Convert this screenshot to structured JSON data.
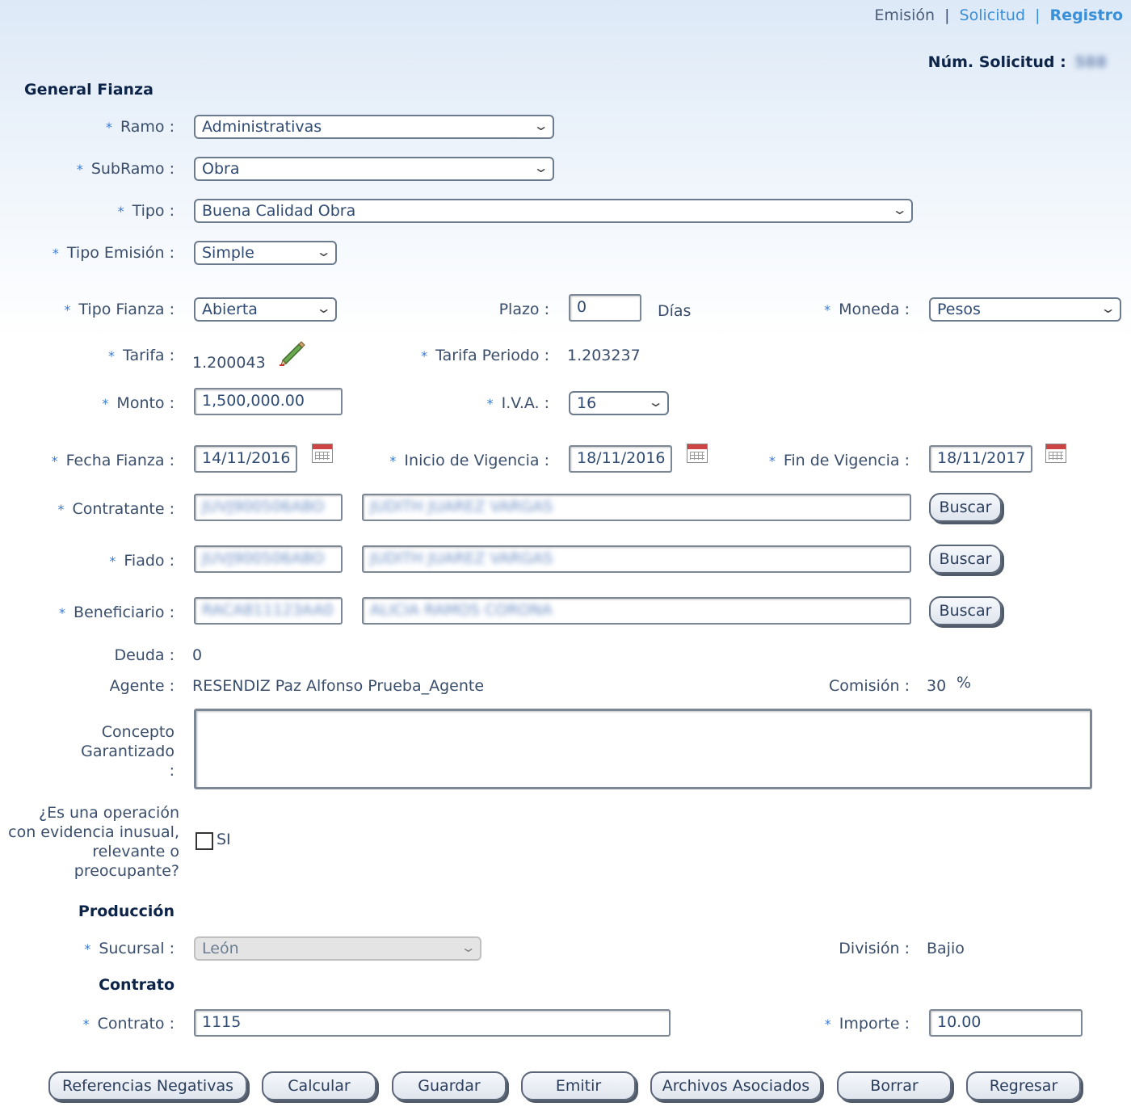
{
  "breadcrumb": {
    "emision": "Emisión",
    "solicitud": "Solicitud",
    "registro": "Registro",
    "sep": "|"
  },
  "num_solicitud": {
    "label": "Núm. Solicitud :",
    "value": "588"
  },
  "general": {
    "title": "General Fianza",
    "ramo": {
      "label": "Ramo :",
      "value": "Administrativas"
    },
    "subramo": {
      "label": "SubRamo :",
      "value": "Obra"
    },
    "tipo": {
      "label": "Tipo :",
      "value": "Buena Calidad Obra"
    },
    "tipo_emision": {
      "label": "Tipo Emisión :",
      "value": "Simple"
    },
    "tipo_fianza": {
      "label": "Tipo Fianza :",
      "value": "Abierta"
    },
    "plazo": {
      "label": "Plazo :",
      "value": "0",
      "unit": "Días"
    },
    "moneda": {
      "label": "Moneda :",
      "value": "Pesos"
    },
    "tarifa": {
      "label": "Tarifa :",
      "value": "1.200043"
    },
    "tarifa_periodo": {
      "label": "Tarifa Periodo :",
      "value": "1.203237"
    },
    "monto": {
      "label": "Monto :",
      "value": "1,500,000.00"
    },
    "iva": {
      "label": "I.V.A. :",
      "value": "16"
    },
    "fecha_fianza": {
      "label": "Fecha Fianza :",
      "value": "14/11/2016"
    },
    "inicio_vigencia": {
      "label": "Inicio de Vigencia :",
      "value": "18/11/2016"
    },
    "fin_vigencia": {
      "label": "Fin de Vigencia :",
      "value": "18/11/2017"
    },
    "contratante": {
      "label": "Contratante :",
      "rfc": "JUVJ900506ABO",
      "name": "JUDITH JUAREZ VARGAS",
      "button": "Buscar"
    },
    "fiado": {
      "label": "Fiado :",
      "rfc": "JUVJ900506ABO",
      "name": "JUDITH JUAREZ VARGAS",
      "button": "Buscar"
    },
    "beneficiario": {
      "label": "Beneficiario :",
      "rfc": "RACA811123AA0",
      "name": "ALICIA RAMOS CORONA",
      "button": "Buscar"
    },
    "deuda": {
      "label": "Deuda :",
      "value": "0"
    },
    "agente": {
      "label": "Agente :",
      "value": "RESENDIZ Paz Alfonso Prueba_Agente"
    },
    "comision": {
      "label": "Comisión :",
      "value": "30",
      "unit": "%"
    },
    "concepto": {
      "label1": "Concepto",
      "label2": "Garantizado",
      "label3": ":",
      "value": ""
    },
    "operacion": {
      "l1": "¿Es una operación",
      "l2": "con evidencia inusual,",
      "l3": "relevante o",
      "l4": "preocupante?",
      "option": "SI",
      "checked": false
    }
  },
  "produccion": {
    "title": "Producción",
    "sucursal": {
      "label": "Sucursal :",
      "value": "León"
    },
    "division": {
      "label": "División :",
      "value": "Bajio"
    }
  },
  "contrato": {
    "title": "Contrato",
    "contrato": {
      "label": "Contrato :",
      "value": "1115"
    },
    "importe": {
      "label": "Importe :",
      "value": "10.00"
    }
  },
  "actions": [
    "Referencias Negativas",
    "Calcular",
    "Guardar",
    "Emitir",
    "Archivos Asociados",
    "Borrar",
    "Regresar"
  ],
  "colors": {
    "label": "#3a4e6c",
    "section": "#0d2449",
    "link": "#3a8fd9",
    "asterisk": "#3a7bd5"
  }
}
